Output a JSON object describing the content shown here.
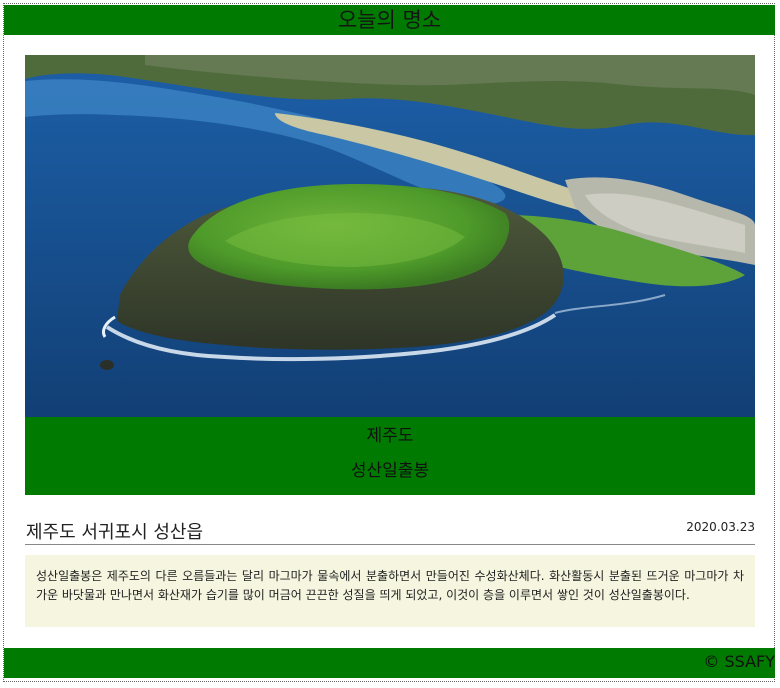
{
  "header": {
    "title": "오늘의 명소"
  },
  "card": {
    "image_alt": "제주도 성산일출봉 항공 사진",
    "caption_region": "제주도",
    "caption_name": "성산일출봉"
  },
  "article": {
    "location": "제주도 서귀포시 성산읍",
    "date": "2020.03.23",
    "description": "성산일출봉은 제주도의 다른 오름들과는 달리 마그마가 물속에서 분출하면서 만들어진 수성화산체다. 화산활동시 분출된 뜨거운 마그마가 차가운 바닷물과 만나면서 화산재가 습기를 많이 머금어 끈끈한 성질을 띄게 되었고, 이것이 층을 이루면서 쌓인 것이 성산일출봉이다."
  },
  "footer": {
    "copyright": "© SSAFY"
  },
  "colors": {
    "brand_green": "#007a00",
    "desc_bg": "#f5f5e0"
  }
}
